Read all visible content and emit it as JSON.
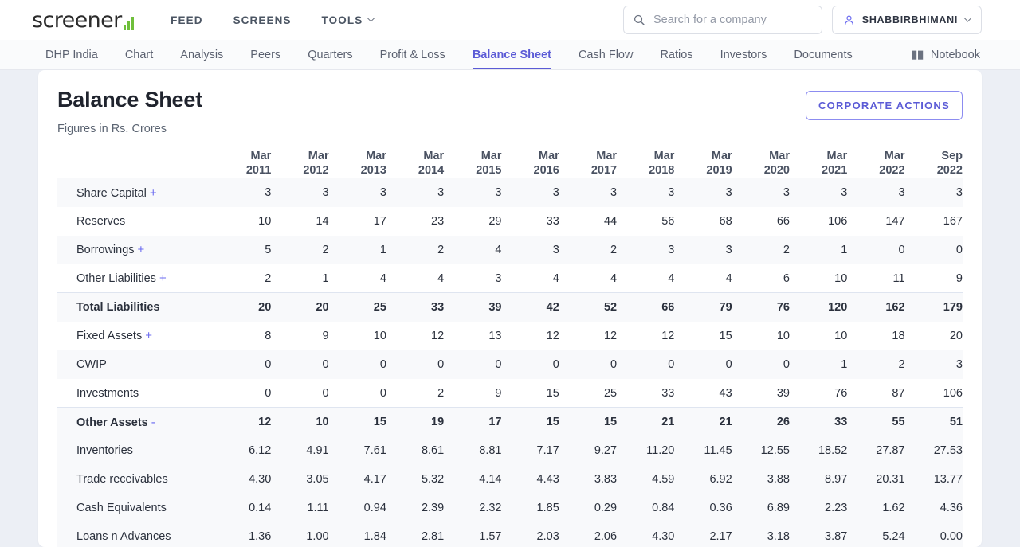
{
  "brand": {
    "name": "screener",
    "bars_color": "#6fbf3b"
  },
  "topnav": {
    "items": [
      {
        "label": "FEED",
        "name": "feed"
      },
      {
        "label": "SCREENS",
        "name": "screens"
      },
      {
        "label": "TOOLS",
        "name": "tools",
        "has_caret": true
      }
    ]
  },
  "search": {
    "placeholder": "Search for a company",
    "value": "",
    "icon": "search-icon"
  },
  "user": {
    "name": "SHABBIRBHIMANI",
    "icon": "user-icon",
    "caret": "chevron-down-icon"
  },
  "subnav": {
    "items": [
      {
        "label": "DHP India",
        "active": false
      },
      {
        "label": "Chart",
        "active": false
      },
      {
        "label": "Analysis",
        "active": false
      },
      {
        "label": "Peers",
        "active": false
      },
      {
        "label": "Quarters",
        "active": false
      },
      {
        "label": "Profit & Loss",
        "active": false
      },
      {
        "label": "Balance Sheet",
        "active": true
      },
      {
        "label": "Cash Flow",
        "active": false
      },
      {
        "label": "Ratios",
        "active": false
      },
      {
        "label": "Investors",
        "active": false
      },
      {
        "label": "Documents",
        "active": false
      }
    ],
    "notebook": {
      "label": "Notebook",
      "icon": "notebook-icon"
    },
    "active_color": "#5b5bd6"
  },
  "header": {
    "title": "Balance Sheet",
    "subtitle": "Figures in Rs. Crores",
    "corporate_actions_label": "CORPORATE ACTIONS"
  },
  "table": {
    "label_header": "",
    "columns": [
      {
        "month": "Mar",
        "year": "2011"
      },
      {
        "month": "Mar",
        "year": "2012"
      },
      {
        "month": "Mar",
        "year": "2013"
      },
      {
        "month": "Mar",
        "year": "2014"
      },
      {
        "month": "Mar",
        "year": "2015"
      },
      {
        "month": "Mar",
        "year": "2016"
      },
      {
        "month": "Mar",
        "year": "2017"
      },
      {
        "month": "Mar",
        "year": "2018"
      },
      {
        "month": "Mar",
        "year": "2019"
      },
      {
        "month": "Mar",
        "year": "2020"
      },
      {
        "month": "Mar",
        "year": "2021"
      },
      {
        "month": "Mar",
        "year": "2022"
      },
      {
        "month": "Sep",
        "year": "2022"
      }
    ],
    "rows": [
      {
        "label": "Share Capital",
        "toggle": "+",
        "type": "normal",
        "stripe": true,
        "values": [
          "3",
          "3",
          "3",
          "3",
          "3",
          "3",
          "3",
          "3",
          "3",
          "3",
          "3",
          "3",
          "3"
        ]
      },
      {
        "label": "Reserves",
        "toggle": "",
        "type": "normal",
        "stripe": false,
        "values": [
          "10",
          "14",
          "17",
          "23",
          "29",
          "33",
          "44",
          "56",
          "68",
          "66",
          "106",
          "147",
          "167"
        ]
      },
      {
        "label": "Borrowings",
        "toggle": "+",
        "type": "normal",
        "stripe": true,
        "values": [
          "5",
          "2",
          "1",
          "2",
          "4",
          "3",
          "2",
          "3",
          "3",
          "2",
          "1",
          "0",
          "0"
        ]
      },
      {
        "label": "Other Liabilities",
        "toggle": "+",
        "type": "normal",
        "stripe": false,
        "values": [
          "2",
          "1",
          "4",
          "4",
          "3",
          "4",
          "4",
          "4",
          "4",
          "6",
          "10",
          "11",
          "9"
        ]
      },
      {
        "label": "Total Liabilities",
        "toggle": "",
        "type": "total",
        "stripe": false,
        "values": [
          "20",
          "20",
          "25",
          "33",
          "39",
          "42",
          "52",
          "66",
          "79",
          "76",
          "120",
          "162",
          "179"
        ]
      },
      {
        "label": "Fixed Assets",
        "toggle": "+",
        "type": "normal",
        "stripe": false,
        "values": [
          "8",
          "9",
          "10",
          "12",
          "13",
          "12",
          "12",
          "12",
          "15",
          "10",
          "10",
          "18",
          "20"
        ]
      },
      {
        "label": "CWIP",
        "toggle": "",
        "type": "normal",
        "stripe": true,
        "values": [
          "0",
          "0",
          "0",
          "0",
          "0",
          "0",
          "0",
          "0",
          "0",
          "0",
          "1",
          "2",
          "3"
        ]
      },
      {
        "label": "Investments",
        "toggle": "",
        "type": "normal",
        "stripe": false,
        "values": [
          "0",
          "0",
          "0",
          "2",
          "9",
          "15",
          "25",
          "33",
          "43",
          "39",
          "76",
          "87",
          "106"
        ]
      },
      {
        "label": "Other Assets",
        "toggle": "-",
        "type": "total",
        "stripe": false,
        "values": [
          "12",
          "10",
          "15",
          "19",
          "17",
          "15",
          "15",
          "21",
          "21",
          "26",
          "33",
          "55",
          "51"
        ]
      },
      {
        "label": "Inventories",
        "toggle": "",
        "type": "sub",
        "stripe": false,
        "values": [
          "6.12",
          "4.91",
          "7.61",
          "8.61",
          "8.81",
          "7.17",
          "9.27",
          "11.20",
          "11.45",
          "12.55",
          "18.52",
          "27.87",
          "27.53"
        ]
      },
      {
        "label": "Trade receivables",
        "toggle": "",
        "type": "sub",
        "stripe": false,
        "values": [
          "4.30",
          "3.05",
          "4.17",
          "5.32",
          "4.14",
          "4.43",
          "3.83",
          "4.59",
          "6.92",
          "3.88",
          "8.97",
          "20.31",
          "13.77"
        ]
      },
      {
        "label": "Cash Equivalents",
        "toggle": "",
        "type": "sub",
        "stripe": false,
        "values": [
          "0.14",
          "1.11",
          "0.94",
          "2.39",
          "2.32",
          "1.85",
          "0.29",
          "0.84",
          "0.36",
          "6.89",
          "2.23",
          "1.62",
          "4.36"
        ]
      },
      {
        "label": "Loans n Advances",
        "toggle": "",
        "type": "sub",
        "stripe": false,
        "values": [
          "1.36",
          "1.00",
          "1.84",
          "2.81",
          "1.57",
          "2.03",
          "2.06",
          "4.30",
          "2.17",
          "3.18",
          "3.87",
          "5.24",
          "0.00"
        ]
      }
    ]
  }
}
